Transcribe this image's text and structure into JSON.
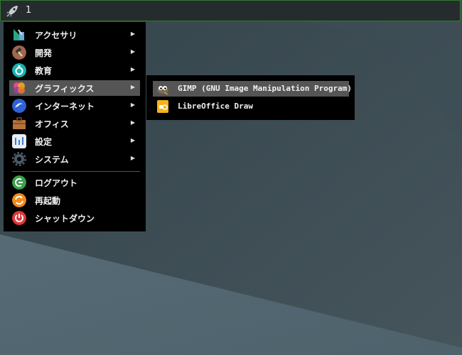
{
  "taskbar": {
    "workspace": "1"
  },
  "menu": {
    "items": [
      {
        "label": "アクセサリ",
        "icon": "accessories-icon"
      },
      {
        "label": "開発",
        "icon": "development-icon"
      },
      {
        "label": "教育",
        "icon": "education-icon"
      },
      {
        "label": "グラフィックス",
        "icon": "graphics-icon"
      },
      {
        "label": "インターネット",
        "icon": "internet-icon"
      },
      {
        "label": "オフィス",
        "icon": "office-icon"
      },
      {
        "label": "設定",
        "icon": "settings-icon"
      },
      {
        "label": "システム",
        "icon": "system-icon"
      }
    ],
    "actions": [
      {
        "label": "ログアウト",
        "icon": "logout-icon"
      },
      {
        "label": "再起動",
        "icon": "reboot-icon"
      },
      {
        "label": "シャットダウン",
        "icon": "shutdown-icon"
      }
    ],
    "arrow": "▶"
  },
  "submenu": {
    "items": [
      {
        "label": "GIMP (GNU Image Manipulation Program)",
        "icon": "gimp-icon"
      },
      {
        "label": "LibreOffice Draw",
        "icon": "libreoffice-draw-icon"
      }
    ]
  }
}
